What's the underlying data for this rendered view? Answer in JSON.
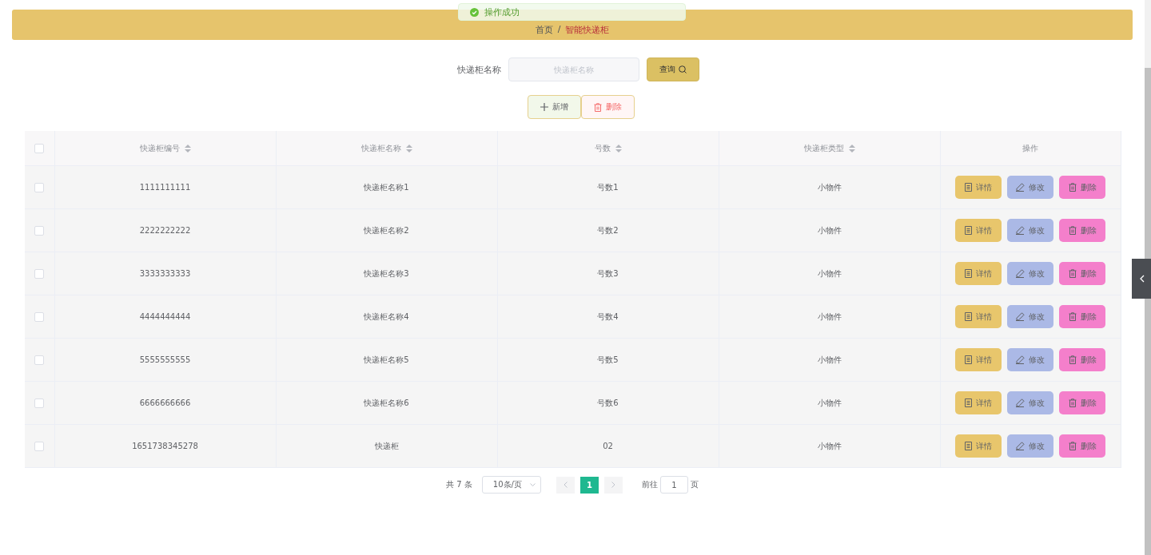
{
  "toast": {
    "message": "操作成功"
  },
  "breadcrumb": [
    {
      "label": "首页",
      "current": false
    },
    {
      "label": "智能快递柜",
      "current": true
    }
  ],
  "breadcrumb_separator": "/",
  "search": {
    "label": "快递柜名称",
    "placeholder": "快递柜名称",
    "button": "查询"
  },
  "actions": [
    {
      "kind": "add",
      "label": "新增"
    },
    {
      "kind": "delete",
      "label": "删除"
    }
  ],
  "table": {
    "select_all": {
      "checked": false
    },
    "columns": [
      {
        "label": "快递柜编号",
        "sortable": true
      },
      {
        "label": "快递柜名称",
        "sortable": true
      },
      {
        "label": "号数",
        "sortable": true
      },
      {
        "label": "快递柜类型",
        "sortable": true
      },
      {
        "label": "操作",
        "sortable": false
      }
    ],
    "rows": [
      {
        "checked": false,
        "cells": [
          "1111111111",
          "快递柜名称1",
          "号数1",
          "小物件"
        ],
        "actions": [
          {
            "kind": "detail",
            "label": "详情"
          },
          {
            "kind": "edit",
            "label": "修改"
          },
          {
            "kind": "delete",
            "label": "删除"
          }
        ]
      },
      {
        "checked": false,
        "cells": [
          "2222222222",
          "快递柜名称2",
          "号数2",
          "小物件"
        ],
        "actions": [
          {
            "kind": "detail",
            "label": "详情"
          },
          {
            "kind": "edit",
            "label": "修改"
          },
          {
            "kind": "delete",
            "label": "删除"
          }
        ]
      },
      {
        "checked": false,
        "cells": [
          "3333333333",
          "快递柜名称3",
          "号数3",
          "小物件"
        ],
        "actions": [
          {
            "kind": "detail",
            "label": "详情"
          },
          {
            "kind": "edit",
            "label": "修改"
          },
          {
            "kind": "delete",
            "label": "删除"
          }
        ]
      },
      {
        "checked": false,
        "cells": [
          "4444444444",
          "快递柜名称4",
          "号数4",
          "小物件"
        ],
        "actions": [
          {
            "kind": "detail",
            "label": "详情"
          },
          {
            "kind": "edit",
            "label": "修改"
          },
          {
            "kind": "delete",
            "label": "删除"
          }
        ]
      },
      {
        "checked": false,
        "cells": [
          "5555555555",
          "快递柜名称5",
          "号数5",
          "小物件"
        ],
        "actions": [
          {
            "kind": "detail",
            "label": "详情"
          },
          {
            "kind": "edit",
            "label": "修改"
          },
          {
            "kind": "delete",
            "label": "删除"
          }
        ]
      },
      {
        "checked": false,
        "cells": [
          "6666666666",
          "快递柜名称6",
          "号数6",
          "小物件"
        ],
        "actions": [
          {
            "kind": "detail",
            "label": "详情"
          },
          {
            "kind": "edit",
            "label": "修改"
          },
          {
            "kind": "delete",
            "label": "删除"
          }
        ]
      },
      {
        "checked": false,
        "cells": [
          "1651738345278",
          "快递柜",
          "02",
          "小物件"
        ],
        "actions": [
          {
            "kind": "detail",
            "label": "详情"
          },
          {
            "kind": "edit",
            "label": "修改"
          },
          {
            "kind": "delete",
            "label": "删除"
          }
        ]
      }
    ]
  },
  "pagination": {
    "total": "共 7 条",
    "page_size": "10条/页",
    "pages": [
      {
        "label": "1",
        "selected": true
      }
    ],
    "goto_label": "前往",
    "goto_value": "1",
    "goto_suffix": "页"
  }
}
